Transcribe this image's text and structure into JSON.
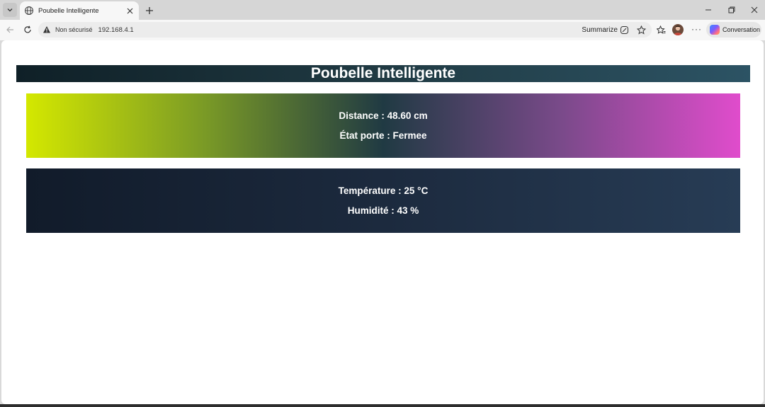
{
  "browser": {
    "tab_title": "Poubelle Intelligente",
    "security_label": "Non sécurisé",
    "url": "192.168.4.1",
    "summarize_label": "Summarize",
    "conversation_label": "Conversation"
  },
  "page": {
    "title": "Poubelle Intelligente",
    "distance_text": "Distance : 48.60 cm",
    "door_state_text": "État porte : Fermee",
    "temperature_text": "Température : 25 °C",
    "humidity_text": "Humidité : 43 %"
  },
  "colors": {
    "title_gradient": [
      "#0f2027",
      "#203a43",
      "#2c5364"
    ],
    "card1_gradient": [
      "#d4e800",
      "#203a43",
      "#e04ccc"
    ],
    "card2_gradient": [
      "#111b2a",
      "#273c55"
    ]
  }
}
